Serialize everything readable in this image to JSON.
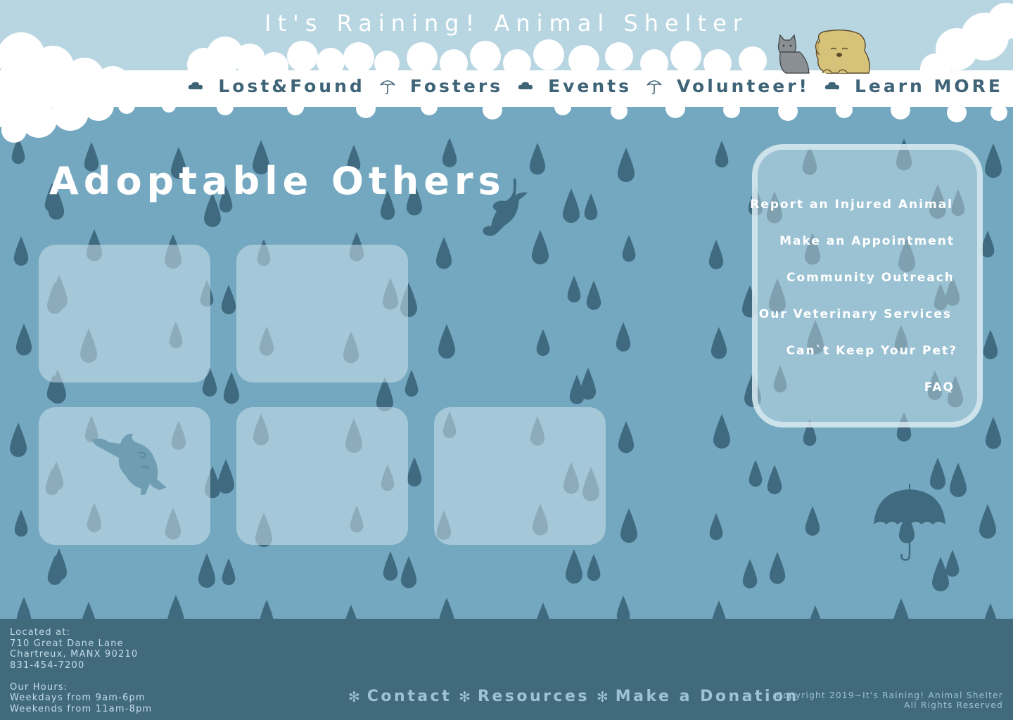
{
  "header": {
    "site_title": "It's Raining! Animal Shelter",
    "nav": [
      {
        "label": "Lost&Found",
        "sep_icon": "cloud-icon"
      },
      {
        "label": "Fosters",
        "sep_icon": "umbrella-icon"
      },
      {
        "label": "Events",
        "sep_icon": "cloud-icon"
      },
      {
        "label": "Volunteer!",
        "sep_icon": "umbrella-icon"
      },
      {
        "label": "Learn MORE",
        "sep_icon": "cloud-icon"
      }
    ]
  },
  "main": {
    "title": "Adoptable Others",
    "cards_count_shown": 5
  },
  "sidebar": {
    "links": [
      "Report an Injured Animal",
      "Make an Appointment",
      "Community Outreach",
      "Our Veterinary Services",
      "Can`t Keep Your Pet?",
      "FAQ"
    ]
  },
  "footer": {
    "address_lines": [
      "Located at:",
      "710 Great Dane Lane",
      "Chartreux, MANX 90210",
      "831-454-7200"
    ],
    "hours_lines": [
      "Our Hours:",
      "Weekdays from 9am-6pm",
      "Weekends from 11am-8pm"
    ],
    "links": [
      "Contact",
      "Resources",
      "Make a Donation"
    ],
    "copyright_line1": "Copyright 2019~It's Raining! Animal Shelter",
    "copyright_line2": "All Rights Reserved"
  },
  "colors": {
    "background": "#74a8c0",
    "sky": "#b8d6e1",
    "cloud": "#ffffff",
    "raindrop": "#3f6a7f",
    "nav_text": "#3f6478",
    "footer": "#426a7d",
    "footer_text": "#9cc4d6"
  }
}
